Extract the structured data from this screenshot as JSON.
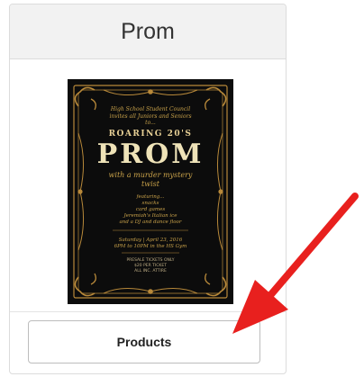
{
  "card": {
    "title": "Prom",
    "button_label": "Products"
  },
  "poster": {
    "intro_line1": "High School Student Council",
    "intro_line2": "invites all Juniors and Seniors",
    "intro_line3": "to...",
    "theme": "ROARING 20'S",
    "headline": "PROM",
    "subtitle_line1": "with a murder mystery",
    "subtitle_line2": "twist",
    "feature_line1": "featuring...",
    "feature_line2": "snacks",
    "feature_line3": "card games",
    "feature_line4": "Jeremiah's Italian ice",
    "feature_line5": "and a DJ and dance floor",
    "date_line1": "Saturday | April 23, 2016",
    "date_line2": "6PM to 10PM in the HS Gym",
    "tix_line1": "PRESALE TICKETS ONLY",
    "tix_line2": "$20 PER TICKET",
    "tix_line3": "ALL INC. ATTIRE"
  },
  "annotation": {
    "arrow_color": "#e8201e"
  }
}
